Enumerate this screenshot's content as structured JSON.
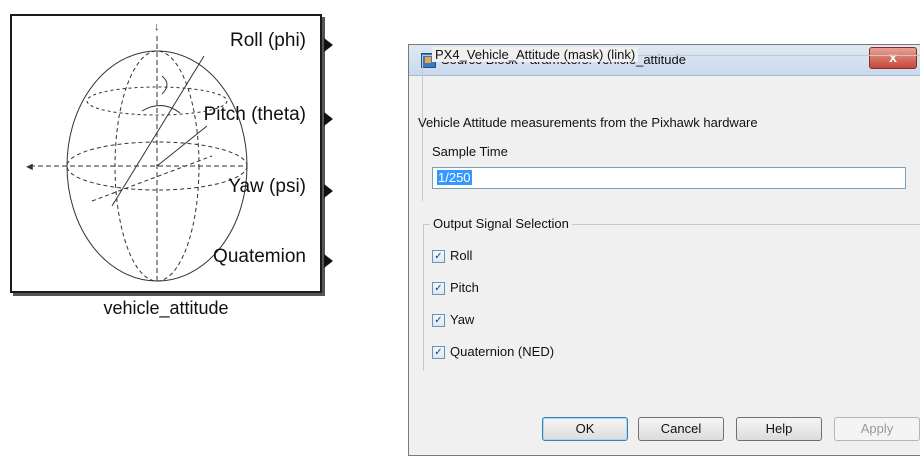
{
  "block": {
    "name": "vehicle_attitude",
    "ports": [
      "Roll (phi)",
      "Pitch (theta)",
      "Yaw (psi)",
      "Quatemion"
    ]
  },
  "dialog": {
    "title": "Source Block Parameters: vehicle_attitude",
    "close_label": "x",
    "mask_group": "PX4_Vehicle_Attitude (mask) (link)",
    "description": "Vehicle Attitude measurements from the Pixhawk hardware",
    "sample_time_label": "Sample Time",
    "sample_time_value": "1/250",
    "output_group": "Output Signal Selection",
    "outputs": [
      {
        "label": "Roll",
        "checked": true
      },
      {
        "label": "Pitch",
        "checked": true
      },
      {
        "label": "Yaw",
        "checked": true
      },
      {
        "label": "Quaternion (NED)",
        "checked": true
      }
    ],
    "buttons": {
      "ok": "OK",
      "cancel": "Cancel",
      "help": "Help",
      "apply": "Apply"
    }
  }
}
